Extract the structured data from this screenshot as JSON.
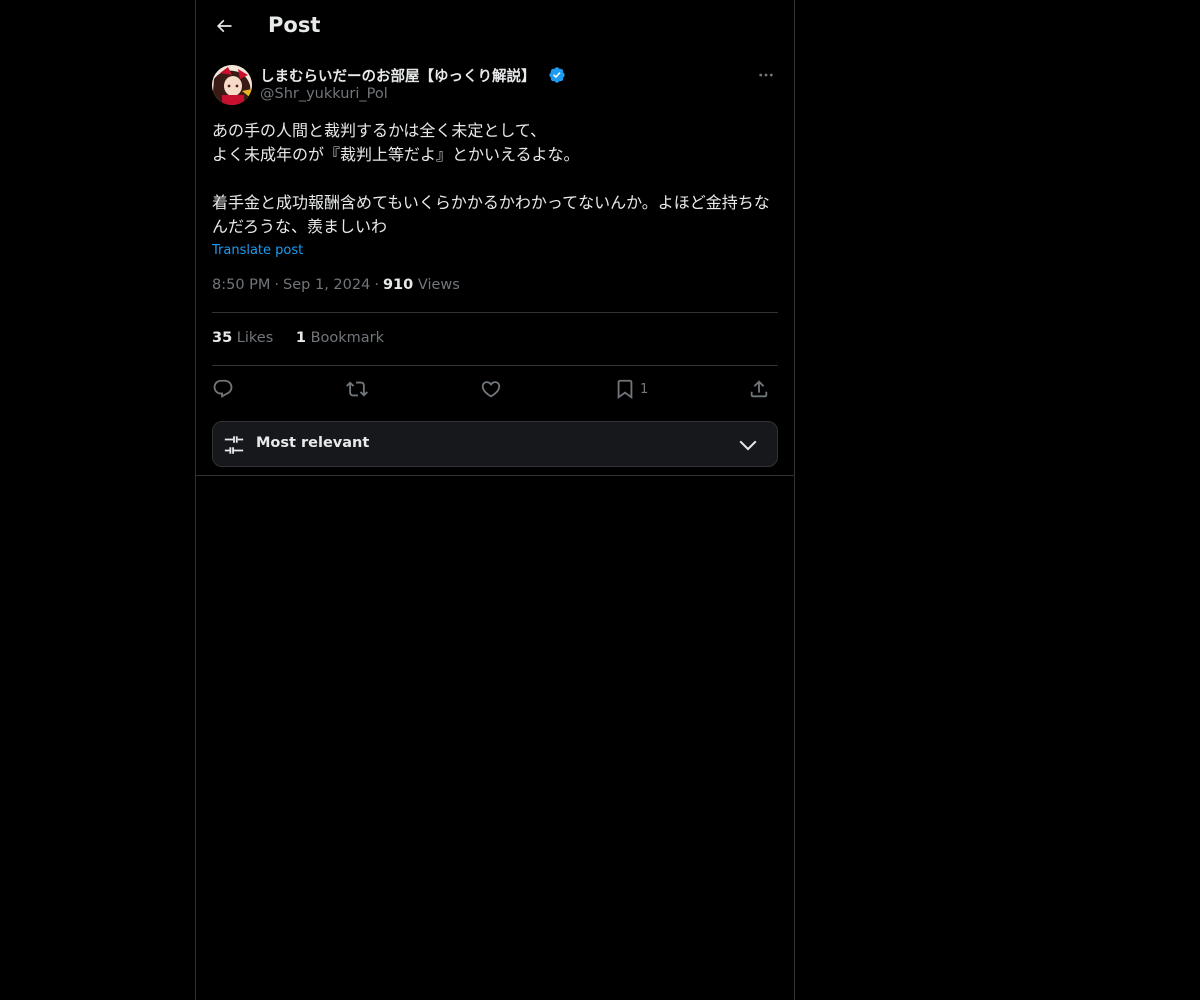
{
  "header": {
    "title": "Post",
    "back_icon": "arrow-left-icon"
  },
  "author": {
    "name": "しまむらいだーのお部屋【ゆっくり解説】",
    "handle": "@Shr_yukkuri_Pol",
    "verified": true,
    "verified_color": "#1d9bf0"
  },
  "post": {
    "text": "あの手の人間と裁判するかは全く未定として、\nよく未成年のが『裁判上等だよ』とかいえるよな。\n\n着手金と成功報酬含めてもいくらかかるかわかってないんか。よほど金持ちなんだろうな、羨ましいわ",
    "translate_label": "Translate post"
  },
  "meta": {
    "time": "8:50 PM",
    "separator": "·",
    "date": "Sep 1, 2024",
    "views_count": "910",
    "views_label": "Views"
  },
  "stats": {
    "likes_count": "35",
    "likes_label": "Likes",
    "bookmarks_count": "1",
    "bookmarks_label": "Bookmark"
  },
  "actions": {
    "reply_icon": "reply-icon",
    "repost_icon": "repost-icon",
    "like_icon": "heart-icon",
    "bookmark_icon": "bookmark-icon",
    "bookmark_count": "1",
    "share_icon": "share-icon"
  },
  "sort": {
    "label": "Most relevant",
    "icon": "sliders-icon",
    "chevron": "chevron-down-icon"
  },
  "colors": {
    "background": "#000000",
    "text": "#e7e9ea",
    "secondary": "#71767b",
    "accent": "#1d9bf0",
    "border": "#2f3336"
  }
}
